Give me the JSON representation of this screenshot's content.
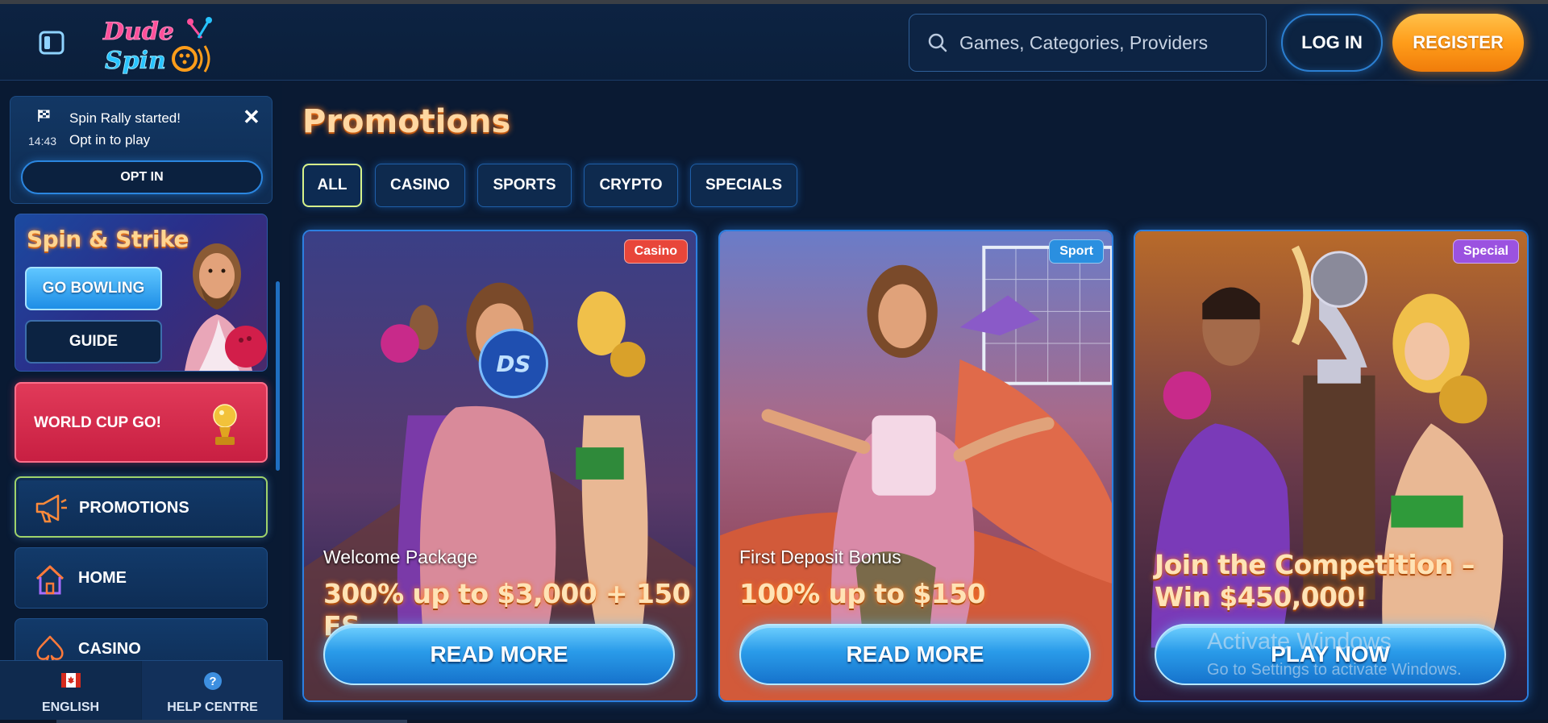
{
  "header": {
    "logo_line1": "Dude",
    "logo_line2": "Spin",
    "search_placeholder": "Games, Categories, Providers",
    "login_label": "LOG IN",
    "register_label": "REGISTER"
  },
  "sidebar": {
    "notice": {
      "time": "14:43",
      "line1": "Spin Rally started!",
      "line2": "Opt in to play",
      "close": "✕",
      "opt_in_label": "OPT IN"
    },
    "spin_strike": {
      "title": "Spin & Strike",
      "go_bowling_label": "GO BOWLING",
      "guide_label": "GUIDE"
    },
    "world_cup_label": "WORLD CUP GO!",
    "nav": [
      {
        "label": "PROMOTIONS",
        "icon": "megaphone-icon",
        "active": true
      },
      {
        "label": "HOME",
        "icon": "home-icon",
        "active": false
      },
      {
        "label": "CASINO",
        "icon": "spade-icon",
        "active": false
      }
    ],
    "footer": {
      "language_label": "ENGLISH",
      "help_label": "HELP CENTRE"
    }
  },
  "main": {
    "title": "Promotions",
    "tabs": [
      {
        "label": "ALL",
        "active": true
      },
      {
        "label": "CASINO",
        "active": false
      },
      {
        "label": "SPORTS",
        "active": false
      },
      {
        "label": "CRYPTO",
        "active": false
      },
      {
        "label": "SPECIALS",
        "active": false
      }
    ],
    "cards": [
      {
        "badge": "Casino",
        "subtitle": "Welcome Package",
        "headline": "300% up to $3,000 + 150 FS",
        "cta": "READ MORE"
      },
      {
        "badge": "Sport",
        "subtitle": "First Deposit Bonus",
        "headline": "100% up to $150",
        "cta": "READ MORE"
      },
      {
        "badge": "Special",
        "subtitle": "",
        "headline": "Join the Competition – Win $450,000!",
        "cta": "PLAY NOW"
      }
    ]
  },
  "watermark": {
    "line1": "Activate Windows",
    "line2": "Go to Settings to activate Windows."
  },
  "colors": {
    "badge_casino": "#e8463a",
    "badge_sport": "#2a8fe0",
    "badge_special": "#9b52e0",
    "accent_orange": "#ff9d1a",
    "accent_blue": "#2b86e0"
  }
}
